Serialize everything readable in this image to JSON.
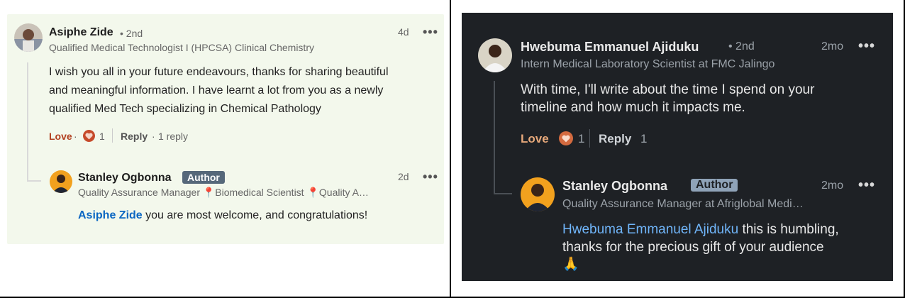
{
  "left": {
    "comment": {
      "name": "Asiphe Zide",
      "degree": "• 2nd",
      "headline": "Qualified Medical Technologist I (HPCSA) Clinical Chemistry",
      "time": "4d",
      "more": "•••",
      "body_lines": [
        "I wish you all in your future endeavours, thanks for sharing beautiful",
        "and meaningful information. I have learnt a lot from you as a newly",
        "qualified Med Tech specializing in Chemical Pathology"
      ],
      "love_label": "Love",
      "sep1": "·",
      "reaction_count": "1",
      "reply_label": "Reply",
      "sep2": "·",
      "replies_count": "1 reply"
    },
    "reply": {
      "name": "Stanley Ogbonna",
      "badge": "Author",
      "headline": "Quality Assurance Manager 📍Biomedical Scientist 📍Quality A…",
      "time": "2d",
      "more": "•••",
      "mention": "Asiphe Zide",
      "text": " you are most welcome, and congratulations!"
    }
  },
  "right": {
    "comment": {
      "name": "Hwebuma Emmanuel Ajiduku",
      "degree": "• 2nd",
      "headline": "Intern Medical Laboratory Scientist at FMC Jalingo",
      "time": "2mo",
      "more": "•••",
      "body_lines": [
        "With time, I'll write about the time I spend on your",
        "timeline and how much it impacts me."
      ],
      "love_label": "Love",
      "reaction_count": "1",
      "reply_label": "Reply",
      "replies_count": "1"
    },
    "reply": {
      "name": "Stanley Ogbonna",
      "badge": "Author",
      "headline": "Quality Assurance Manager at Afriglobal Medi…",
      "time": "2mo",
      "more": "•••",
      "mention": "Hwebuma Emmanuel Ajiduku",
      "text_line1": " this is humbling,",
      "text_line2": "thanks for the precious gift of your audience",
      "emoji": "🙏"
    }
  },
  "colors": {
    "love_light": "#b24020",
    "mention_light": "#0a66c2",
    "love_dark": "#e6a87a",
    "mention_dark": "#70b5f9"
  }
}
